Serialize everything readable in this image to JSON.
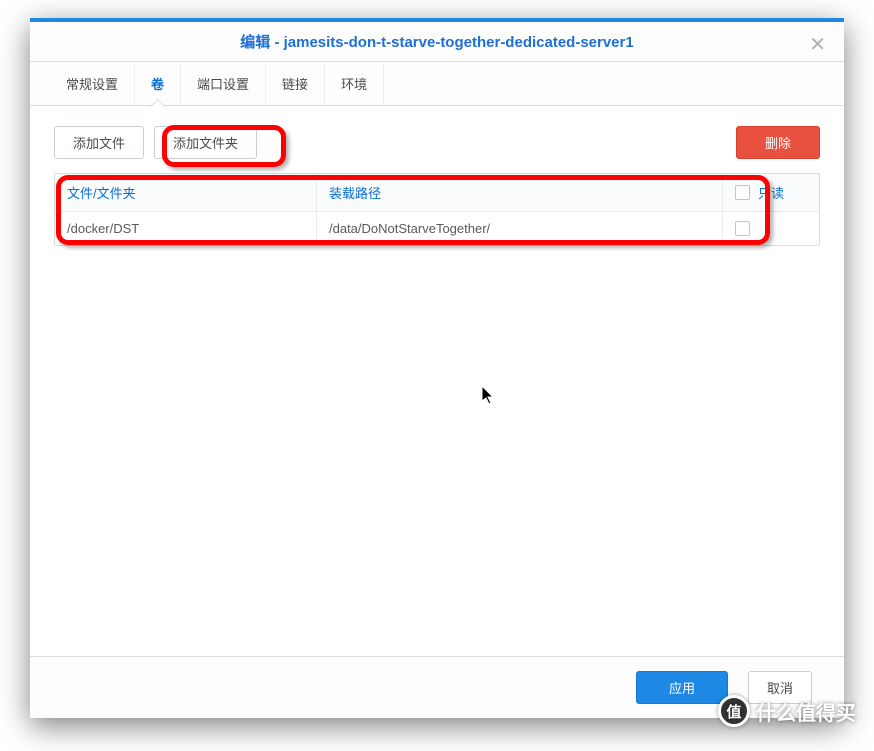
{
  "title": "编辑 - jamesits-don-t-starve-together-dedicated-server1",
  "tabs": [
    {
      "label": "常规设置",
      "active": false
    },
    {
      "label": "卷",
      "active": true
    },
    {
      "label": "端口设置",
      "active": false
    },
    {
      "label": "链接",
      "active": false
    },
    {
      "label": "环境",
      "active": false
    }
  ],
  "toolbar": {
    "add_file": "添加文件",
    "add_folder": "添加文件夹",
    "delete": "删除"
  },
  "table": {
    "headers": {
      "path": "文件/文件夹",
      "mount": "装载路径",
      "readonly": "只读"
    },
    "rows": [
      {
        "path": "/docker/DST",
        "mount": "/data/DoNotStarveTogether/",
        "readonly": false
      }
    ]
  },
  "footer": {
    "apply": "应用",
    "cancel": "取消"
  },
  "watermark": "什么值得买",
  "watermark_badge": "值"
}
